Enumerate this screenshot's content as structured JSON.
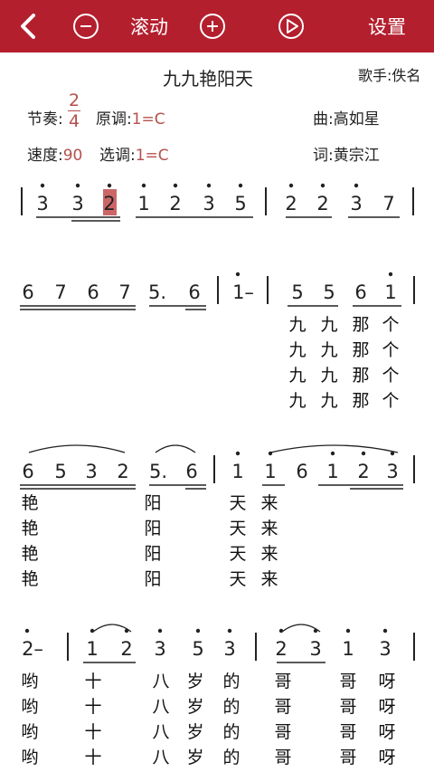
{
  "toolbar": {
    "back_icon": "chevron-left-icon",
    "minus_icon": "circle-minus-icon",
    "scroll_label": "滚动",
    "plus_icon": "circle-plus-icon",
    "play_icon": "circle-play-icon",
    "settings_label": "设置"
  },
  "song": {
    "title": "九九艳阳天",
    "singer": "歌手:佚名",
    "rhythm_label": "节奏:",
    "rhythm_top": "2",
    "rhythm_bottom": "4",
    "original_key_label": "原调:",
    "original_key": "1=C",
    "composer": "曲:高如星",
    "tempo_label": "速度:",
    "tempo": "90",
    "selected_key_label": "选调:",
    "selected_key": "1=C",
    "lyricist": "词:黄宗江"
  },
  "colors": {
    "toolbar": "#b41f2e",
    "meta_value": "#b5504c",
    "current_note_highlight": "#cc6666"
  },
  "score": {
    "rows": [
      {
        "notes": [
          {
            "t": "3",
            "dot": "up"
          },
          {
            "t": "3",
            "dot": "up"
          },
          {
            "t": "2",
            "dot": "up",
            "hl": true
          },
          {
            "t": "1",
            "dot": "up"
          },
          {
            "t": "2",
            "dot": "up"
          },
          {
            "t": "3",
            "dot": "up"
          },
          {
            "t": "5",
            "dot": "up"
          },
          {
            "t": "|"
          },
          {
            "t": "2",
            "dot": "up"
          },
          {
            "t": "2",
            "dot": "up"
          },
          {
            "t": "3",
            "dot": "up"
          },
          {
            "t": "7"
          }
        ],
        "lyrics": []
      },
      {
        "notes": [
          {
            "t": "6"
          },
          {
            "t": "7"
          },
          {
            "t": "6"
          },
          {
            "t": "7"
          },
          {
            "t": "5."
          },
          {
            "t": "6"
          },
          {
            "t": "|"
          },
          {
            "t": "1–",
            "dot": "up"
          },
          {
            "t": "|"
          },
          {
            "t": "5"
          },
          {
            "t": "5"
          },
          {
            "t": "6"
          },
          {
            "t": "1",
            "dot": "up"
          }
        ],
        "lyrics": [
          [
            "九",
            "九",
            "那",
            "个"
          ],
          [
            "九",
            "九",
            "那",
            "个"
          ],
          [
            "九",
            "九",
            "那",
            "个"
          ],
          [
            "九",
            "九",
            "那",
            "个"
          ]
        ]
      },
      {
        "notes": [
          {
            "t": "6"
          },
          {
            "t": "5"
          },
          {
            "t": "3"
          },
          {
            "t": "2"
          },
          {
            "t": "5."
          },
          {
            "t": "6"
          },
          {
            "t": "|"
          },
          {
            "t": "1",
            "dot": "up"
          },
          {
            "t": "1",
            "dot": "up"
          },
          {
            "t": "6"
          },
          {
            "t": "1",
            "dot": "up"
          },
          {
            "t": "2",
            "dot": "up"
          },
          {
            "t": "3",
            "dot": "up"
          }
        ],
        "lyrics": [
          [
            "艳",
            "阳",
            "天",
            "来"
          ],
          [
            "艳",
            "阳",
            "天",
            "来"
          ],
          [
            "艳",
            "阳",
            "天",
            "来"
          ],
          [
            "艳",
            "阳",
            "天",
            "来"
          ]
        ]
      },
      {
        "notes": [
          {
            "t": "2–",
            "dot": "up"
          },
          {
            "t": "|"
          },
          {
            "t": "1",
            "dot": "up"
          },
          {
            "t": "2",
            "dot": "up"
          },
          {
            "t": "3",
            "dot": "up"
          },
          {
            "t": "5",
            "dot": "up"
          },
          {
            "t": "3",
            "dot": "up"
          },
          {
            "t": "|"
          },
          {
            "t": "2",
            "dot": "up"
          },
          {
            "t": "3",
            "dot": "up"
          },
          {
            "t": "1",
            "dot": "up"
          },
          {
            "t": "3",
            "dot": "up"
          }
        ],
        "lyrics": [
          [
            "哟",
            "十",
            "八",
            "岁",
            "的",
            "哥",
            "哥",
            "呀"
          ],
          [
            "哟",
            "十",
            "八",
            "岁",
            "的",
            "哥",
            "哥",
            "呀"
          ],
          [
            "哟",
            "十",
            "八",
            "岁",
            "的",
            "哥",
            "哥",
            "呀"
          ],
          [
            "哟",
            "十",
            "八",
            "岁",
            "的",
            "哥",
            "哥",
            "呀"
          ]
        ]
      }
    ]
  }
}
